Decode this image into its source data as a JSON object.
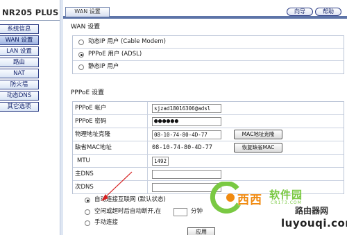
{
  "brand": "NR205 PLUS",
  "sidebar": {
    "items": [
      {
        "label": "系统信息"
      },
      {
        "label": "WAN 设置"
      },
      {
        "label": "LAN 设置"
      },
      {
        "label": "路由"
      },
      {
        "label": "NAT"
      },
      {
        "label": "防火墙"
      },
      {
        "label": "动态DNS"
      },
      {
        "label": "其它选项"
      }
    ]
  },
  "header": {
    "tab": "WAN 设置",
    "wizard_label": "向导",
    "help_label": "帮助"
  },
  "wan": {
    "title": "WAN 设置",
    "options": [
      {
        "label": "动态IP 用户  (Cable Modem)",
        "selected": false
      },
      {
        "label": "PPPoE 用户  (ADSL)",
        "selected": true
      },
      {
        "label": "静态IP 用户",
        "selected": false
      }
    ]
  },
  "pppoe": {
    "title": "PPPoE 设置",
    "account_label": "PPPoE 帐户",
    "account_value": "sjzad18016306@adsl",
    "password_label": "PPPoE 密码",
    "password_value": "●●●●●●",
    "mac_clone_label": "物理地址克隆",
    "mac_clone_value": "08-10-74-80-4D-77",
    "mac_clone_button": "MAC地址克隆",
    "default_mac_label": "缺省MAC地址",
    "default_mac_value": "08-10-74-80-4D-77",
    "restore_mac_button": "恢复缺省MAC",
    "mtu_label": "MTU",
    "mtu_value": "1492",
    "primary_dns_label": "主DNS",
    "primary_dns_value": "",
    "secondary_dns_label": "次DNS",
    "secondary_dns_value": ""
  },
  "connection": {
    "options": [
      {
        "label": "自动连接互联网  (默认状态)",
        "selected": true
      },
      {
        "label": "空闲或超时后自动断开,在",
        "selected": false,
        "suffix": "分钟"
      },
      {
        "label": "手动连接",
        "selected": false
      }
    ],
    "idle_minutes": ""
  },
  "apply_label": "应用",
  "watermarks": {
    "logo_text_orange": "西西",
    "logo_text_green": "软件园",
    "logo_sub": "CR173.COM",
    "site_cn": "路由器网",
    "site_url": "luyouqi.com"
  },
  "colors": {
    "nav_border": "#2d3e86",
    "rail": "#5d74a8",
    "watermark_orange": "#f08a10",
    "watermark_green": "#7ac943",
    "arrow": "#d62020"
  }
}
